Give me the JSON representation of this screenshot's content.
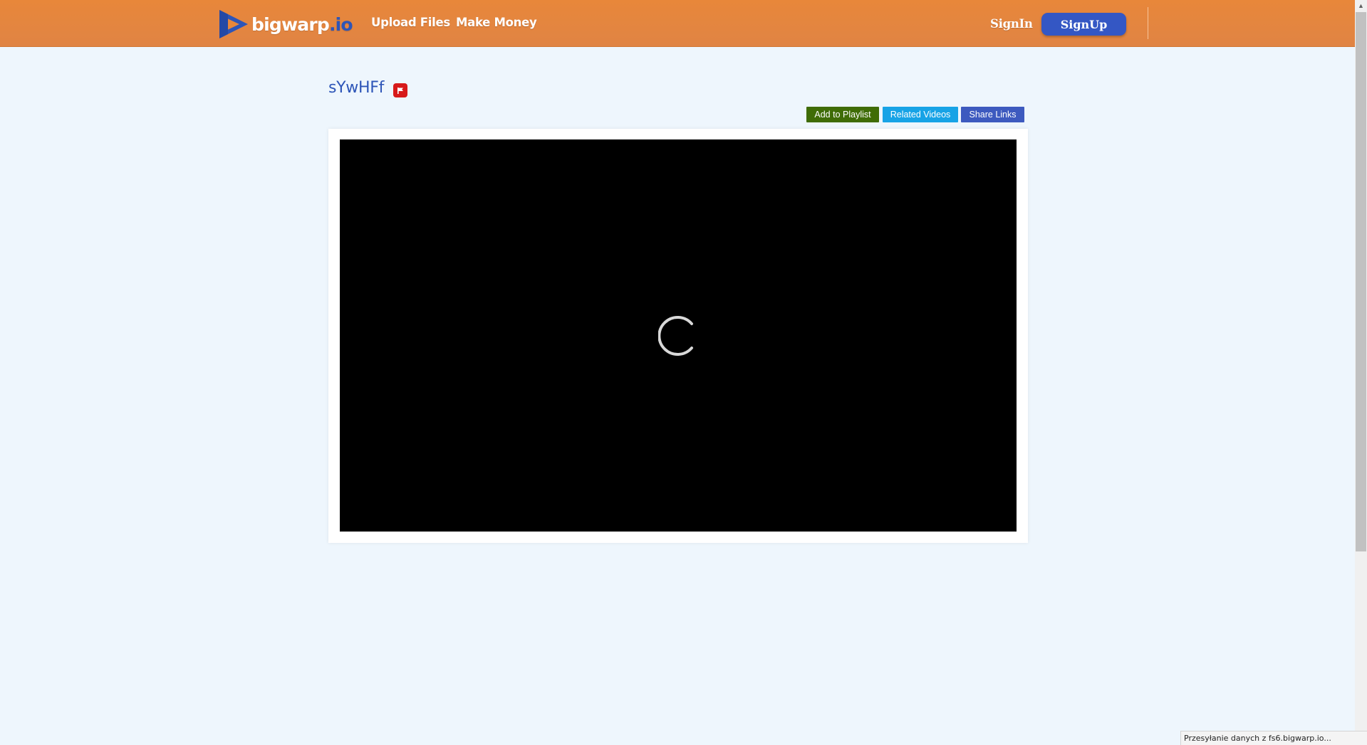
{
  "header": {
    "logo": {
      "name": "bigwarp",
      "tld": ".io",
      "icon": "play-logo-icon"
    },
    "nav": {
      "upload": "Upload Files",
      "money": "Make Money"
    },
    "signin": "SignIn",
    "signup": "SignUp"
  },
  "video": {
    "title": "sYwHFf",
    "report_icon": "flag-icon"
  },
  "actions": {
    "playlist": "Add to Playlist",
    "related": "Related Videos",
    "share": "Share Links"
  },
  "player": {
    "state": "loading",
    "indicator_icon": "loading-spinner-icon"
  },
  "status_bar": {
    "text": "Przesyłanie danych z fs6.bigwarp.io..."
  },
  "colors": {
    "header": "#e28640",
    "brand_blue": "#2d55b8",
    "signup": "#3457c4",
    "playlist": "#3f6c06",
    "related": "#17a3e6",
    "share": "#3d5abf",
    "report": "#d71a1a",
    "page_bg": "#eef6fd"
  }
}
